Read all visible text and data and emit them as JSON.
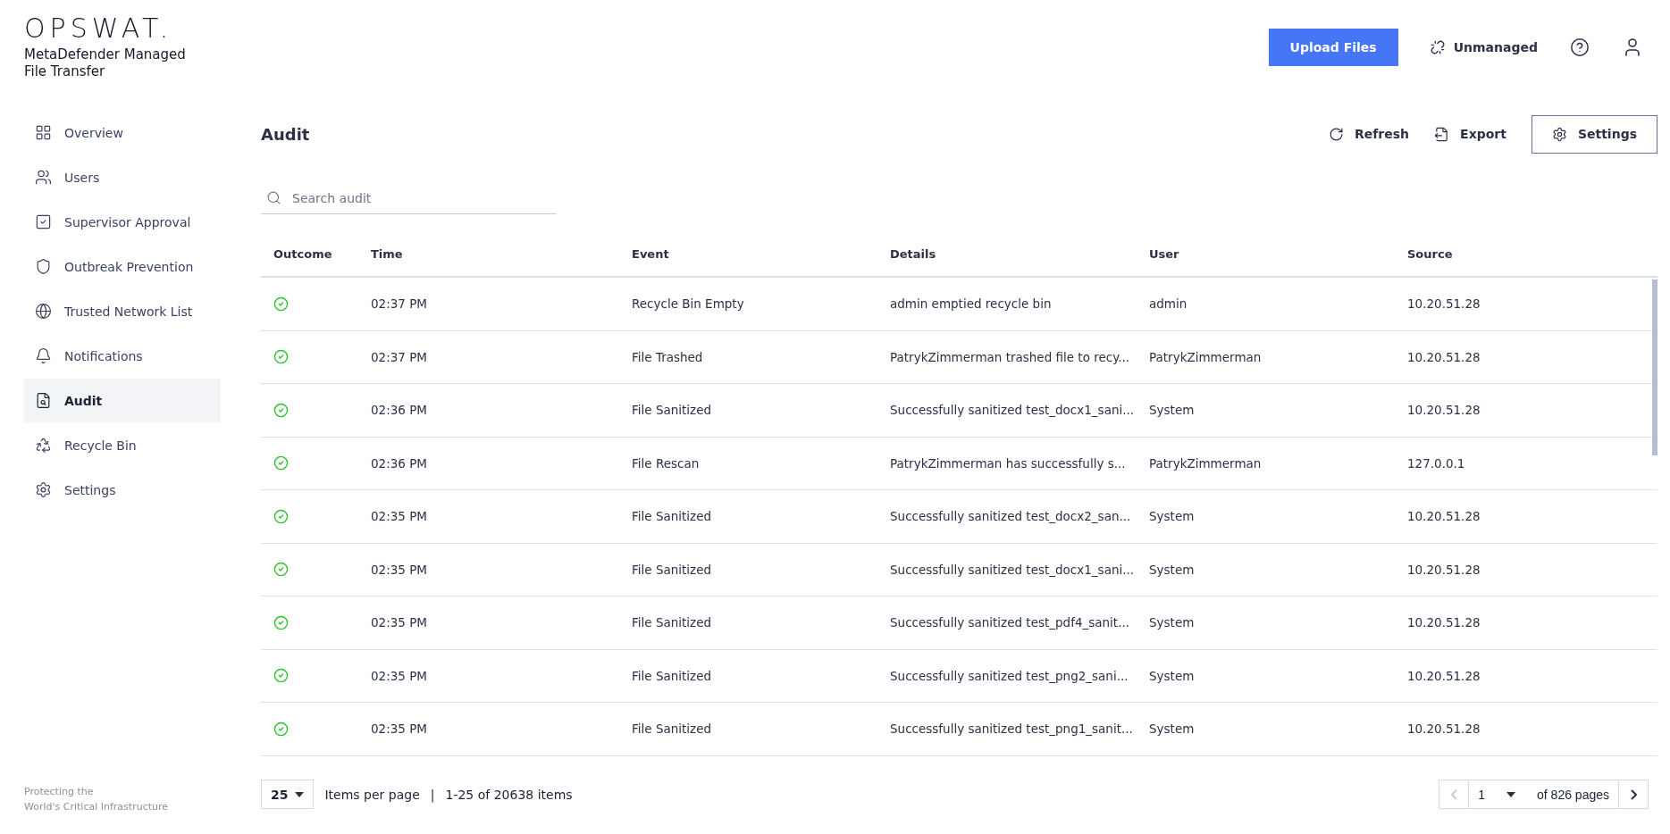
{
  "brand": {
    "logo": "OPSWAT.",
    "product": "MetaDefender Managed File Transfer",
    "tagline_lines": [
      "Protecting the",
      "World's Critical Infrastructure"
    ]
  },
  "header": {
    "upload_button": "Upload Files",
    "status_link": "Unmanaged"
  },
  "sidebar": {
    "items": [
      {
        "label": "Overview",
        "selected": false
      },
      {
        "label": "Users",
        "selected": false
      },
      {
        "label": "Supervisor Approval",
        "selected": false
      },
      {
        "label": "Outbreak Prevention",
        "selected": false
      },
      {
        "label": "Trusted Network List",
        "selected": false
      },
      {
        "label": "Notifications",
        "selected": false
      },
      {
        "label": "Audit",
        "selected": true
      },
      {
        "label": "Recycle Bin",
        "selected": false
      },
      {
        "label": "Settings",
        "selected": false
      }
    ]
  },
  "page": {
    "title": "Audit",
    "actions": [
      {
        "label": "Refresh",
        "kind": "refresh"
      },
      {
        "label": "Export",
        "kind": "export"
      },
      {
        "label": "Settings",
        "kind": "settings"
      }
    ],
    "search": {
      "placeholder": "Search audit"
    }
  },
  "table": {
    "columns": [
      "Outcome",
      "Time",
      "Event",
      "Details",
      "User",
      "Source"
    ],
    "rows": [
      {
        "success": true,
        "time": "02:37 PM",
        "event": "Recycle Bin Empty",
        "details": "admin emptied recycle bin",
        "user": "admin",
        "source": "10.20.51.28"
      },
      {
        "success": true,
        "time": "02:37 PM",
        "event": "File Trashed",
        "details": "PatrykZimmerman trashed file to recy...",
        "user": "PatrykZimmerman",
        "source": "10.20.51.28"
      },
      {
        "success": true,
        "time": "02:36 PM",
        "event": "File Sanitized",
        "details": "Successfully sanitized test_docx1_sani...",
        "user": "System",
        "source": "10.20.51.28"
      },
      {
        "success": true,
        "time": "02:36 PM",
        "event": "File Rescan",
        "details": "PatrykZimmerman has successfully s...",
        "user": "PatrykZimmerman",
        "source": "127.0.0.1"
      },
      {
        "success": true,
        "time": "02:35 PM",
        "event": "File Sanitized",
        "details": "Successfully sanitized test_docx2_san...",
        "user": "System",
        "source": "10.20.51.28"
      },
      {
        "success": true,
        "time": "02:35 PM",
        "event": "File Sanitized",
        "details": "Successfully sanitized test_docx1_sani...",
        "user": "System",
        "source": "10.20.51.28"
      },
      {
        "success": true,
        "time": "02:35 PM",
        "event": "File Sanitized",
        "details": "Successfully sanitized test_pdf4_sanit...",
        "user": "System",
        "source": "10.20.51.28"
      },
      {
        "success": true,
        "time": "02:35 PM",
        "event": "File Sanitized",
        "details": "Successfully sanitized test_png2_sani...",
        "user": "System",
        "source": "10.20.51.28"
      },
      {
        "success": true,
        "time": "02:35 PM",
        "event": "File Sanitized",
        "details": "Successfully sanitized test_png1_sanit...",
        "user": "System",
        "source": "10.20.51.28"
      }
    ]
  },
  "pagination": {
    "page_size": "25",
    "page_size_label": "Items per page",
    "separator": "|",
    "range": "1-25 of 20638 items",
    "page": "1",
    "page_count": "of 826 pages",
    "prev_disabled": true,
    "next_disabled": false
  }
}
